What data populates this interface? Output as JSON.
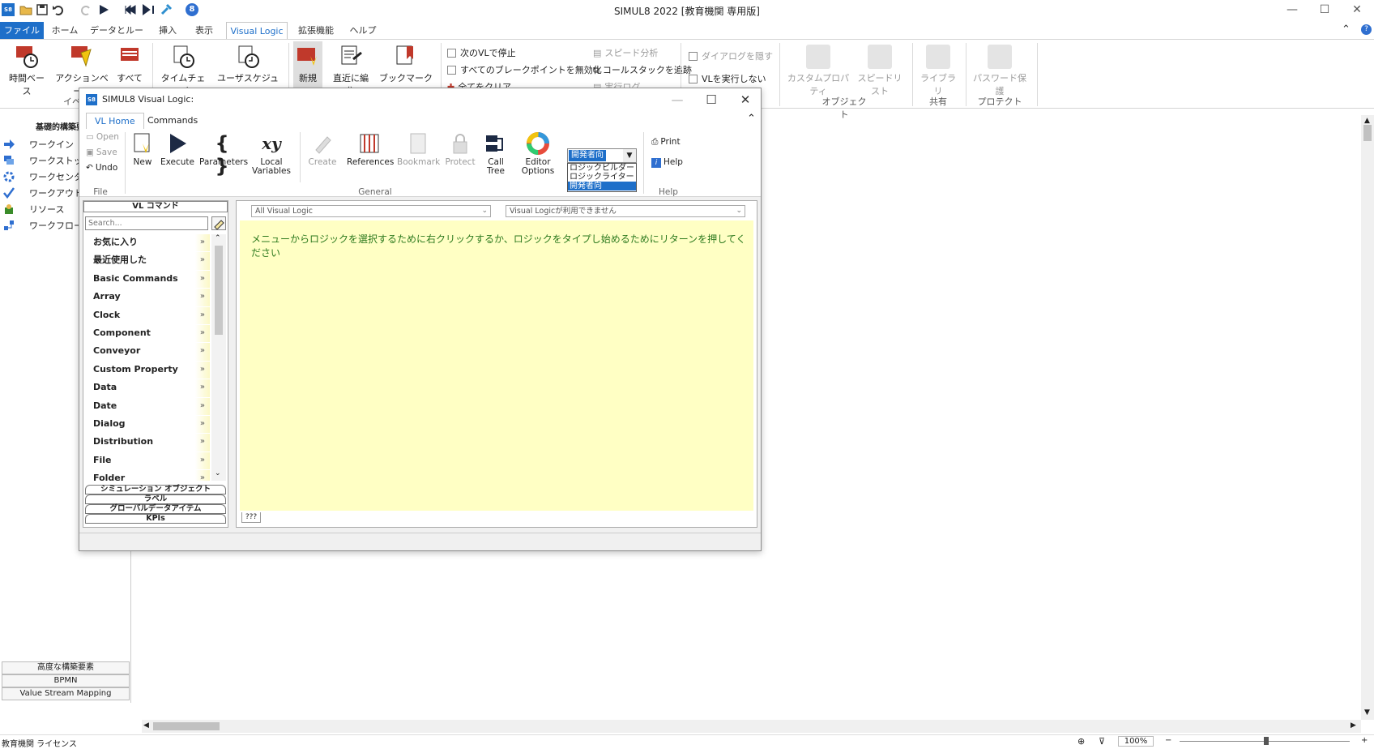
{
  "app": {
    "title": "SIMUL8 2022 [教育機関 専用版]"
  },
  "ribbon": {
    "tabs": [
      "ファイル",
      "ホーム",
      "データとルール",
      "挿入",
      "表示",
      "Visual Logic",
      "拡張機能",
      "ヘルプ"
    ],
    "buttons": {
      "time_based": "時間ベース",
      "action_based": "アクションベース",
      "all": "すべて",
      "time_check": "タイムチェック",
      "user_schedule": "ユーザスケジュール",
      "new": "新規",
      "recent_edit": "直近に編集",
      "to_bookmark": "ブックマークへ",
      "stop_at_next_vl": "次のVLで停止",
      "disable_all_breakpoints": "すべてのブレークポイントを無効化",
      "clear_all": "全てをクリア",
      "speed_analysis": "スピード分析",
      "call_stack_trace": "コールスタックを追跡",
      "execution_log": "実行ログ",
      "hide_dialog": "ダイアログを隠す",
      "dont_run_vl": "VLを実行しない",
      "custom_property": "カスタムプロパティ",
      "speed_list": "スピードリスト",
      "library": "ライブラリ",
      "password_protect": "パスワード保護"
    },
    "groups": {
      "event": "イベ",
      "object": "オブジェクト",
      "share": "共有",
      "protect": "プロテクト"
    }
  },
  "left_panel": {
    "header": "基礎的構築要",
    "items": [
      "ワークイン",
      "ワークストッ",
      "ワークセンタ",
      "ワークアウト",
      "リソース",
      "ワークフローを"
    ],
    "bottom": [
      "高度な構築要素",
      "BPMN",
      "Value Stream Mapping"
    ]
  },
  "status_bar": {
    "license": "教育機関 ライセンス",
    "zoom": "100%"
  },
  "dialog": {
    "title": "SIMUL8 Visual Logic:",
    "tabs": [
      "VL Home",
      "Commands"
    ],
    "file": {
      "open": "Open",
      "save": "Save",
      "undo": "Undo",
      "group": "File"
    },
    "general": {
      "new": "New",
      "execute": "Execute",
      "parameters": "Parameters",
      "local_variables": "Local Variables",
      "create": "Create",
      "references": "References",
      "bookmark": "Bookmark",
      "protect": "Protect",
      "call_tree": "Call Tree",
      "editor_options": "Editor Options",
      "group": "General"
    },
    "mode": {
      "selected": "開発者向",
      "options": [
        "ロジックビルダー",
        "ロジックライター",
        "開発者向"
      ]
    },
    "help": {
      "print": "Print",
      "help": "Help",
      "group": "Help"
    },
    "commands_panel": {
      "header": "VL コマンド",
      "search_placeholder": "Search...",
      "items": [
        "お気に入り",
        "最近使用した",
        "Basic Commands",
        "Array",
        "Clock",
        "Component",
        "Conveyor",
        "Custom Property",
        "Data",
        "Date",
        "Dialog",
        "Distribution",
        "File",
        "Folder"
      ],
      "categories": [
        "シミュレーション オブジェクト",
        "ラベル",
        "グローバルデータアイテム",
        "KPIs"
      ]
    },
    "editor": {
      "scope_combo": "All Visual Logic",
      "vl_combo": "Visual Logicが利用できません",
      "hint": "メニューからロジックを選択するために右クリックするか、ロジックをタイプし始めるためにリターンを押してください",
      "tab": "???"
    }
  }
}
